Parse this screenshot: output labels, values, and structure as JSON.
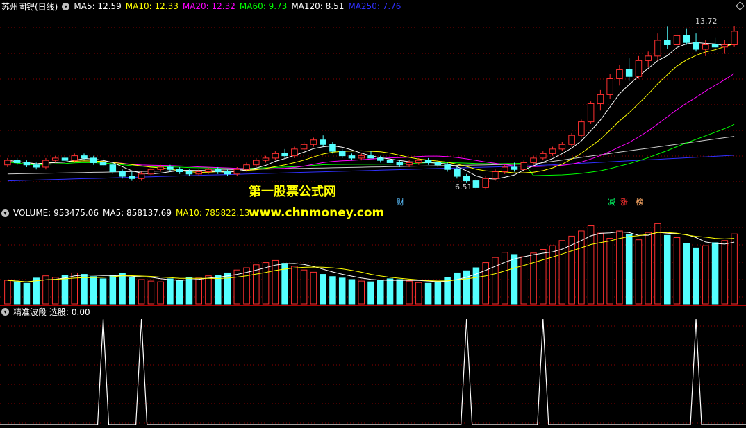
{
  "price_panel": {
    "stock_name": "苏州固锝(日线)",
    "ma_labels": [
      {
        "text": "MA5: 12.59",
        "color": "#ffffff"
      },
      {
        "text": "MA10: 12.33",
        "color": "#ffff00"
      },
      {
        "text": "MA20: 12.32",
        "color": "#ff00ff"
      },
      {
        "text": "MA60: 9.73",
        "color": "#00ff00"
      },
      {
        "text": "MA120: 8.51",
        "color": "#ffffff"
      },
      {
        "text": "MA250: 7.76",
        "color": "#3030ff"
      }
    ],
    "high_label": "13.72",
    "low_label": "6.51",
    "marks": [
      {
        "text": "财",
        "color": "#5bc0ff"
      },
      {
        "text": "减",
        "color": "#00ff66"
      },
      {
        "text": "涨",
        "color": "#ff3030"
      },
      {
        "text": "榜",
        "color": "#ffaa66"
      }
    ]
  },
  "volume_panel": {
    "labels": [
      {
        "text": "VOLUME: 953475.06",
        "color": "#ffffff"
      },
      {
        "text": "MA5: 858137.69",
        "color": "#ffffff"
      },
      {
        "text": "MA10: 785822.13",
        "color": "#ffff00"
      }
    ]
  },
  "indicator_panel": {
    "title": "精准波段",
    "label": "选股: 0.00"
  },
  "watermark": {
    "line1": "第一股票公式网",
    "line2": "www.chnmoney.com"
  },
  "colors": {
    "up": "#ff3030",
    "down": "#54ffff",
    "grid": "#8b0000"
  },
  "chart_data": {
    "type": "candlestick",
    "ohlc": [
      [
        7.6,
        7.9,
        7.5,
        7.8
      ],
      [
        7.8,
        7.9,
        7.6,
        7.7
      ],
      [
        7.7,
        7.8,
        7.5,
        7.6
      ],
      [
        7.6,
        7.7,
        7.4,
        7.5
      ],
      [
        7.5,
        7.9,
        7.4,
        7.8
      ],
      [
        7.8,
        8.0,
        7.7,
        7.9
      ],
      [
        7.9,
        8.0,
        7.7,
        7.8
      ],
      [
        7.8,
        8.1,
        7.7,
        8.0
      ],
      [
        8.0,
        8.1,
        7.8,
        7.9
      ],
      [
        7.9,
        8.0,
        7.6,
        7.7
      ],
      [
        7.7,
        7.9,
        7.5,
        7.6
      ],
      [
        7.6,
        7.7,
        7.2,
        7.3
      ],
      [
        7.3,
        7.4,
        7.0,
        7.1
      ],
      [
        7.1,
        7.3,
        6.9,
        7.0
      ],
      [
        7.0,
        7.3,
        6.9,
        7.2
      ],
      [
        7.2,
        7.5,
        7.1,
        7.4
      ],
      [
        7.4,
        7.6,
        7.3,
        7.5
      ],
      [
        7.5,
        7.6,
        7.3,
        7.4
      ],
      [
        7.4,
        7.5,
        7.2,
        7.3
      ],
      [
        7.3,
        7.4,
        7.1,
        7.2
      ],
      [
        7.2,
        7.4,
        7.1,
        7.3
      ],
      [
        7.3,
        7.5,
        7.2,
        7.4
      ],
      [
        7.4,
        7.5,
        7.2,
        7.3
      ],
      [
        7.3,
        7.4,
        7.1,
        7.2
      ],
      [
        7.2,
        7.5,
        7.1,
        7.4
      ],
      [
        7.4,
        7.7,
        7.3,
        7.6
      ],
      [
        7.6,
        7.9,
        7.5,
        7.8
      ],
      [
        7.8,
        8.0,
        7.7,
        7.9
      ],
      [
        7.9,
        8.2,
        7.8,
        8.1
      ],
      [
        8.1,
        8.3,
        7.9,
        8.0
      ],
      [
        8.0,
        8.4,
        7.9,
        8.3
      ],
      [
        8.3,
        8.6,
        8.2,
        8.5
      ],
      [
        8.5,
        8.8,
        8.4,
        8.7
      ],
      [
        8.7,
        8.9,
        8.4,
        8.5
      ],
      [
        8.5,
        8.6,
        8.1,
        8.2
      ],
      [
        8.2,
        8.3,
        7.9,
        8.0
      ],
      [
        8.0,
        8.1,
        7.8,
        7.9
      ],
      [
        7.9,
        8.1,
        7.8,
        8.0
      ],
      [
        8.0,
        8.2,
        7.9,
        7.9
      ],
      [
        7.9,
        8.0,
        7.7,
        7.8
      ],
      [
        7.8,
        7.9,
        7.6,
        7.7
      ],
      [
        7.7,
        7.8,
        7.5,
        7.6
      ],
      [
        7.6,
        7.8,
        7.5,
        7.7
      ],
      [
        7.7,
        7.9,
        7.6,
        7.8
      ],
      [
        7.8,
        7.9,
        7.6,
        7.7
      ],
      [
        7.7,
        7.8,
        7.5,
        7.6
      ],
      [
        7.6,
        7.7,
        7.3,
        7.4
      ],
      [
        7.4,
        7.5,
        7.0,
        7.1
      ],
      [
        7.1,
        7.2,
        6.8,
        6.9
      ],
      [
        6.9,
        7.0,
        6.5,
        6.6
      ],
      [
        6.6,
        7.1,
        6.51,
        7.0
      ],
      [
        7.0,
        7.4,
        6.9,
        7.3
      ],
      [
        7.3,
        7.6,
        7.2,
        7.5
      ],
      [
        7.5,
        7.7,
        7.3,
        7.4
      ],
      [
        7.4,
        7.8,
        7.3,
        7.7
      ],
      [
        7.7,
        8.0,
        7.6,
        7.9
      ],
      [
        7.9,
        8.2,
        7.8,
        8.1
      ],
      [
        8.1,
        8.4,
        8.0,
        8.3
      ],
      [
        8.3,
        8.6,
        8.2,
        8.5
      ],
      [
        8.5,
        9.0,
        8.4,
        8.9
      ],
      [
        8.9,
        9.6,
        8.8,
        9.5
      ],
      [
        9.5,
        10.4,
        9.4,
        10.3
      ],
      [
        10.3,
        10.9,
        10.0,
        10.7
      ],
      [
        10.7,
        11.6,
        10.5,
        11.4
      ],
      [
        11.4,
        12.0,
        11.1,
        11.8
      ],
      [
        11.8,
        12.3,
        11.3,
        11.5
      ],
      [
        11.5,
        12.4,
        11.4,
        12.2
      ],
      [
        12.2,
        12.6,
        11.9,
        12.4
      ],
      [
        12.4,
        13.4,
        12.2,
        13.1
      ],
      [
        13.1,
        13.7,
        12.7,
        12.9
      ],
      [
        12.9,
        13.5,
        12.6,
        13.3
      ],
      [
        13.3,
        13.6,
        12.9,
        13.0
      ],
      [
        13.0,
        13.4,
        12.6,
        12.7
      ],
      [
        12.7,
        13.1,
        12.4,
        12.9
      ],
      [
        12.9,
        13.2,
        12.6,
        12.8
      ],
      [
        12.8,
        13.1,
        12.5,
        12.9
      ],
      [
        12.9,
        13.72,
        12.8,
        13.5
      ]
    ],
    "volume": [
      3.2,
      3.0,
      2.8,
      3.5,
      3.8,
      3.6,
      3.9,
      4.2,
      4.0,
      3.7,
      3.4,
      3.9,
      4.1,
      3.6,
      3.3,
      3.1,
      3.0,
      3.4,
      3.2,
      3.6,
      3.5,
      3.8,
      3.9,
      4.2,
      4.6,
      4.9,
      5.3,
      5.6,
      5.9,
      5.5,
      5.1,
      4.6,
      4.3,
      4.0,
      3.7,
      3.5,
      3.3,
      3.1,
      3.0,
      3.2,
      3.4,
      3.3,
      3.1,
      2.9,
      2.8,
      3.0,
      3.6,
      4.2,
      4.5,
      4.9,
      5.6,
      6.3,
      7.0,
      6.7,
      6.4,
      6.9,
      7.4,
      7.9,
      8.6,
      9.2,
      9.9,
      10.6,
      9.6,
      8.9,
      9.9,
      9.4,
      8.7,
      9.7,
      10.9,
      9.3,
      9.0,
      8.2,
      7.6,
      7.9,
      8.3,
      8.6,
      9.5
    ],
    "signal_peaks": [
      10,
      14,
      48,
      56,
      72
    ]
  }
}
